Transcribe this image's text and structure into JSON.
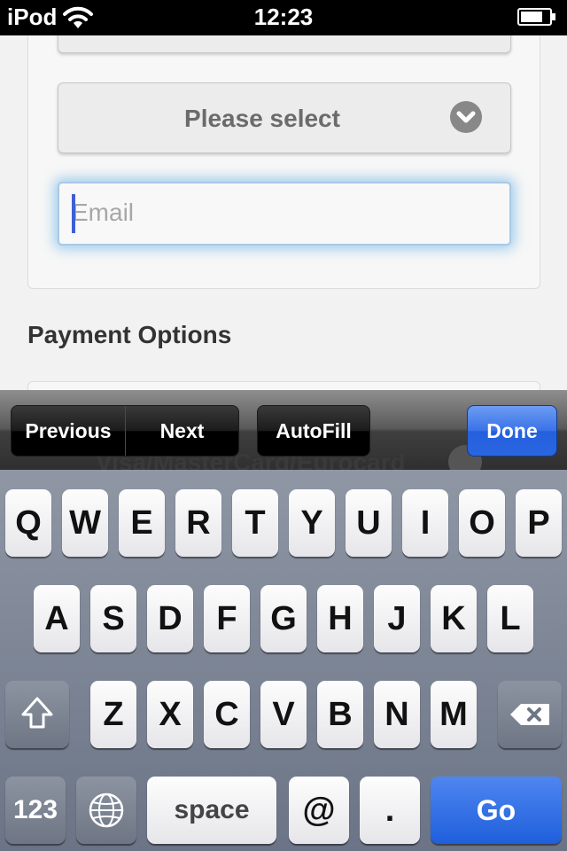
{
  "status_bar": {
    "carrier": "iPod",
    "time": "12:23"
  },
  "form": {
    "select_label": "Please select",
    "email_placeholder": "Email",
    "email_value": "",
    "payment_title": "Payment Options",
    "payment_peek_text": "Visa/MasterCard/Eurocard"
  },
  "toolbar": {
    "previous": "Previous",
    "next": "Next",
    "autofill": "AutoFill",
    "done": "Done"
  },
  "keyboard": {
    "row1": [
      "Q",
      "W",
      "E",
      "R",
      "T",
      "Y",
      "U",
      "I",
      "O",
      "P"
    ],
    "row2": [
      "A",
      "S",
      "D",
      "F",
      "G",
      "H",
      "J",
      "K",
      "L"
    ],
    "row3": [
      "Z",
      "X",
      "C",
      "V",
      "B",
      "N",
      "M"
    ],
    "numbers": "123",
    "space": "space",
    "at": "@",
    "dot": ".",
    "go": "Go"
  },
  "colors": {
    "accent_blue": "#2a66e0",
    "focus_glow": "#5aaae6"
  }
}
